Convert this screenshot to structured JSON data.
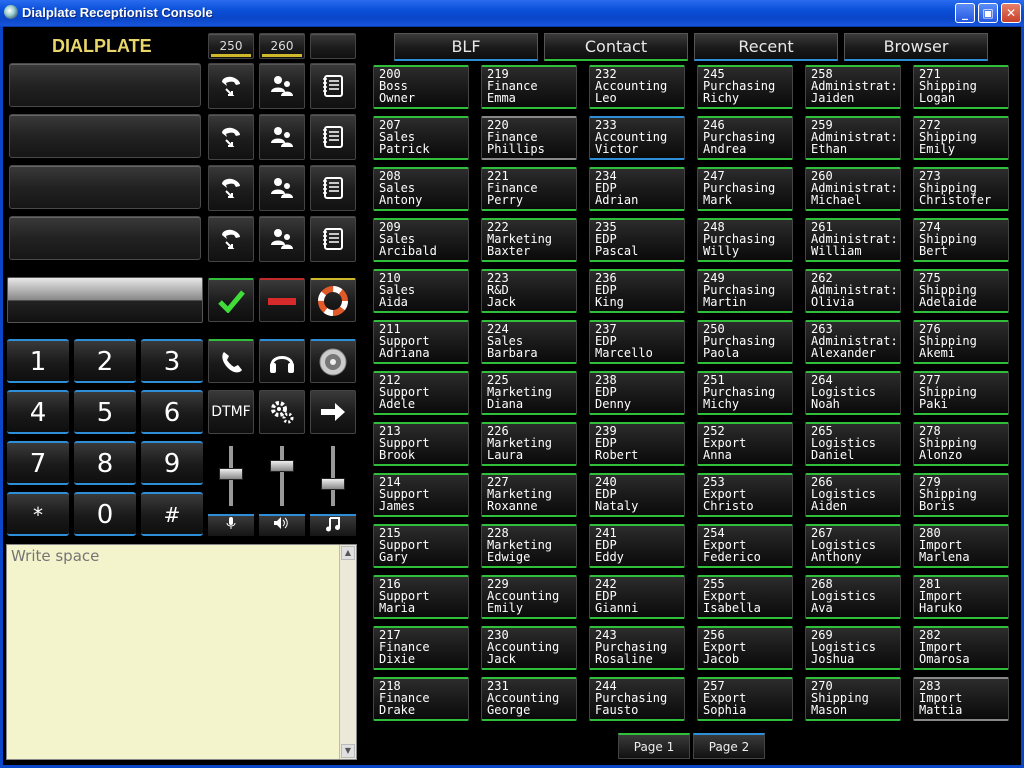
{
  "window": {
    "title": "Dialplate Receptionist Console"
  },
  "logo": "DIALPLATE",
  "line_counts": [
    "250",
    "260",
    ""
  ],
  "keypad": [
    "1",
    "2",
    "3",
    "4",
    "5",
    "6",
    "7",
    "8",
    "9",
    "*",
    "0",
    "#"
  ],
  "dtmf_label": "DTMF",
  "notes": {
    "placeholder": "Write space"
  },
  "tabs": [
    "BLF",
    "Contact",
    "Recent",
    "Browser"
  ],
  "pages": [
    "Page 1",
    "Page 2"
  ],
  "extensions": [
    [
      "200",
      "Boss",
      "Owner"
    ],
    [
      "207",
      "Sales",
      "Patrick"
    ],
    [
      "208",
      "Sales",
      "Antony"
    ],
    [
      "209",
      "Sales",
      "Arcibald"
    ],
    [
      "210",
      "Sales",
      "Aida"
    ],
    [
      "211",
      "Support",
      "Adriana"
    ],
    [
      "212",
      "Support",
      "Adele"
    ],
    [
      "213",
      "Support",
      "Brook"
    ],
    [
      "214",
      "Support",
      "James"
    ],
    [
      "215",
      "Support",
      "Gary"
    ],
    [
      "216",
      "Support",
      "Maria"
    ],
    [
      "217",
      "Finance",
      "Dixie"
    ],
    [
      "218",
      "Finance",
      "Drake"
    ],
    [
      "219",
      "Finance",
      "Emma"
    ],
    [
      "220",
      "Finance",
      "Phillips"
    ],
    [
      "221",
      "Finance",
      "Perry"
    ],
    [
      "222",
      "Marketing",
      "Baxter"
    ],
    [
      "223",
      "R&D",
      "Jack"
    ],
    [
      "224",
      "Sales",
      "Barbara"
    ],
    [
      "225",
      "Marketing",
      "Diana"
    ],
    [
      "226",
      "Marketing",
      "Laura"
    ],
    [
      "227",
      "Marketing",
      "Roxanne"
    ],
    [
      "228",
      "Marketing",
      "Edwige"
    ],
    [
      "229",
      "Accounting",
      "Emily"
    ],
    [
      "230",
      "Accounting",
      "Jack"
    ],
    [
      "231",
      "Accounting",
      "George"
    ],
    [
      "232",
      "Accounting",
      "Leo"
    ],
    [
      "233",
      "Accounting",
      "Victor"
    ],
    [
      "234",
      "EDP",
      "Adrian"
    ],
    [
      "235",
      "EDP",
      "Pascal"
    ],
    [
      "236",
      "EDP",
      "King"
    ],
    [
      "237",
      "EDP",
      "Marcello"
    ],
    [
      "238",
      "EDP",
      "Denny"
    ],
    [
      "239",
      "EDP",
      "Robert"
    ],
    [
      "240",
      "EDP",
      "Nataly"
    ],
    [
      "241",
      "EDP",
      "Eddy"
    ],
    [
      "242",
      "EDP",
      "Gianni"
    ],
    [
      "243",
      "Purchasing",
      "Rosaline"
    ],
    [
      "244",
      "Purchasing",
      "Fausto"
    ],
    [
      "245",
      "Purchasing",
      "Richy"
    ],
    [
      "246",
      "Purchasing",
      "Andrea"
    ],
    [
      "247",
      "Purchasing",
      "Mark"
    ],
    [
      "248",
      "Purchasing",
      "Willy"
    ],
    [
      "249",
      "Purchasing",
      "Martin"
    ],
    [
      "250",
      "Purchasing",
      "Paola"
    ],
    [
      "251",
      "Purchasing",
      "Michy"
    ],
    [
      "252",
      "Export",
      "Anna"
    ],
    [
      "253",
      "Export",
      "Christo"
    ],
    [
      "254",
      "Export",
      "Federico"
    ],
    [
      "255",
      "Export",
      "Isabella"
    ],
    [
      "256",
      "Export",
      "Jacob"
    ],
    [
      "257",
      "Export",
      "Sophia"
    ],
    [
      "258",
      "Administrat:",
      "Jaiden"
    ],
    [
      "259",
      "Administrat:",
      "Ethan"
    ],
    [
      "260",
      "Administrat:",
      "Michael"
    ],
    [
      "261",
      "Administrat:",
      "William"
    ],
    [
      "262",
      "Administrat:",
      "Olivia"
    ],
    [
      "263",
      "Administrat:",
      "Alexander"
    ],
    [
      "264",
      "Logistics",
      "Noah"
    ],
    [
      "265",
      "Logistics",
      "Daniel"
    ],
    [
      "266",
      "Logistics",
      "Aiden"
    ],
    [
      "267",
      "Logistics",
      "Anthony"
    ],
    [
      "268",
      "Logistics",
      "Ava"
    ],
    [
      "269",
      "Logistics",
      "Joshua"
    ],
    [
      "270",
      "Shipping",
      "Mason"
    ],
    [
      "271",
      "Shipping",
      "Logan"
    ],
    [
      "272",
      "Shipping",
      "Emily"
    ],
    [
      "273",
      "Shipping",
      "Christofer"
    ],
    [
      "274",
      "Shipping",
      "Bert"
    ],
    [
      "275",
      "Shipping",
      "Adelaide"
    ],
    [
      "276",
      "Shipping",
      "Akemi"
    ],
    [
      "277",
      "Shipping",
      "Paki"
    ],
    [
      "278",
      "Shipping",
      "Alonzo"
    ],
    [
      "279",
      "Shipping",
      "Boris"
    ],
    [
      "280",
      "Import",
      "Marlena"
    ],
    [
      "281",
      "Import",
      "Haruko"
    ],
    [
      "282",
      "Import",
      "Omarosa"
    ],
    [
      "283",
      "Import",
      "Mattia"
    ]
  ],
  "extension_status": [
    "green",
    "green",
    "green",
    "green",
    "green",
    "green",
    "green",
    "green",
    "green",
    "green",
    "green",
    "green",
    "green",
    "green",
    "gray",
    "green",
    "green",
    "green",
    "green",
    "green",
    "green",
    "green",
    "green",
    "green",
    "green",
    "green",
    "green",
    "blue",
    "green",
    "green",
    "green",
    "green",
    "green",
    "green",
    "green",
    "green",
    "green",
    "green",
    "green",
    "green",
    "green",
    "green",
    "green",
    "green",
    "green",
    "green",
    "green",
    "green",
    "green",
    "green",
    "green",
    "green",
    "green",
    "green",
    "green",
    "green",
    "green",
    "green",
    "green",
    "green",
    "green",
    "green",
    "green",
    "green",
    "green",
    "green",
    "green",
    "green",
    "green",
    "green",
    "green",
    "green",
    "green",
    "green",
    "green",
    "green",
    "green",
    "gray"
  ],
  "colors": {
    "accent_green": "#2fbf3a",
    "accent_blue": "#2e8fd8",
    "accent_yellow": "#cfb82a",
    "titlebar": "#0a4fd8"
  }
}
